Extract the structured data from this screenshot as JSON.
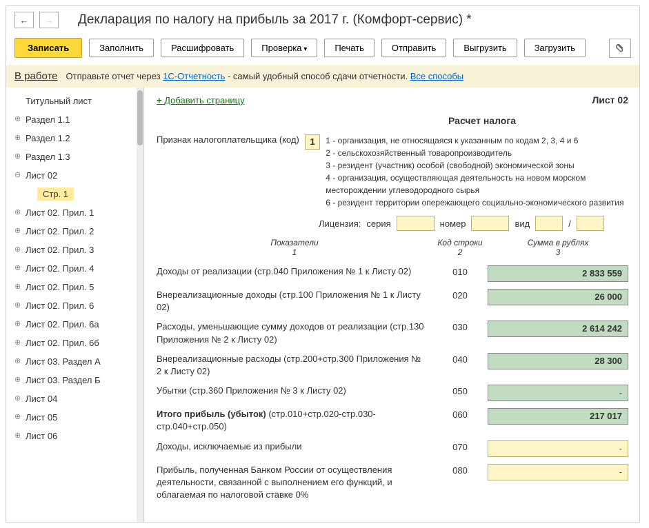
{
  "title": "Декларация по налогу на прибыль за 2017 г. (Комфорт-сервис) *",
  "toolbar": {
    "save": "Записать",
    "fill": "Заполнить",
    "decode": "Расшифровать",
    "check": "Проверка",
    "print": "Печать",
    "send": "Отправить",
    "export": "Выгрузить",
    "import": "Загрузить"
  },
  "info": {
    "status": "В работе",
    "text1": "Отправьте отчет через ",
    "link1": "1С-Отчетность",
    "text2": " - самый удобный способ сдачи отчетности. ",
    "link2": "Все способы"
  },
  "sidebar": [
    {
      "label": "Титульный лист",
      "leaf": true
    },
    {
      "label": "Раздел 1.1"
    },
    {
      "label": "Раздел 1.2"
    },
    {
      "label": "Раздел 1.3"
    },
    {
      "label": "Лист 02",
      "expanded": true
    },
    {
      "label": "Стр. 1",
      "level": 1,
      "leaf": true,
      "active": true
    },
    {
      "label": "Лист 02. Прил. 1"
    },
    {
      "label": "Лист 02. Прил. 2"
    },
    {
      "label": "Лист 02. Прил. 3"
    },
    {
      "label": "Лист 02. Прил. 4"
    },
    {
      "label": "Лист 02. Прил. 5"
    },
    {
      "label": "Лист 02. Прил. 6"
    },
    {
      "label": "Лист 02. Прил. 6а"
    },
    {
      "label": "Лист 02. Прил. 6б"
    },
    {
      "label": "Лист 03. Раздел А"
    },
    {
      "label": "Лист 03. Раздел Б"
    },
    {
      "label": "Лист 04"
    },
    {
      "label": "Лист 05"
    },
    {
      "label": "Лист 06"
    }
  ],
  "content": {
    "add_page": "Добавить страницу",
    "list_label": "Лист 02",
    "section_title": "Расчет налога",
    "taxpayer_label": "Признак налогоплательщика (код)",
    "taxpayer_code": "1",
    "legend": [
      "1 - организация, не относящаяся к указанным по кодам 2, 3, 4 и 6",
      "2 - сельскохозяйственный товаропроизводитель",
      "3 - резидент (участник) особой (свободной) экономической зоны",
      "4 - организация, осуществляющая деятельность на новом морском месторождении углеводородного сырья",
      "6 - резидент территории опережающего социально-экономического развития"
    ],
    "license": {
      "label": "Лицензия:",
      "series": "серия",
      "number": "номер",
      "type": "вид",
      "sep": "/"
    },
    "headers": {
      "indicator": "Показатели",
      "indicator_num": "1",
      "code": "Код строки",
      "code_num": "2",
      "sum": "Сумма в рублях",
      "sum_num": "3"
    },
    "rows": [
      {
        "label": "Доходы от реализации (стр.040 Приложения № 1 к Листу 02)",
        "code": "010",
        "value": "2 833 559",
        "style": "green"
      },
      {
        "label": "Внереализационные доходы (стр.100 Приложения № 1 к Листу 02)",
        "code": "020",
        "value": "26 000",
        "style": "green"
      },
      {
        "label": "Расходы, уменьшающие сумму доходов от реализации (стр.130 Приложения № 2 к Листу 02)",
        "code": "030",
        "value": "2 614 242",
        "style": "green"
      },
      {
        "label": "Внереализационные расходы (стр.200+стр.300 Приложения № 2 к Листу 02)",
        "code": "040",
        "value": "28 300",
        "style": "green"
      },
      {
        "label": "Убытки (стр.360 Приложения № 3 к Листу 02)",
        "code": "050",
        "value": "-",
        "style": "green",
        "empty": true
      },
      {
        "label": "Итого прибыль (убыток)",
        "extra": "(стр.010+стр.020-стр.030-стр.040+стр.050)",
        "bold": true,
        "code": "060",
        "value": "217 017",
        "style": "green"
      },
      {
        "label": "Доходы, исключаемые из прибыли",
        "code": "070",
        "value": "-",
        "style": "yellow",
        "empty": true
      },
      {
        "label": "Прибыль, полученная Банком России от осуществления деятельности, связанной с выполнением его функций, и облагаемая по налоговой ставке 0%",
        "code": "080",
        "value": "-",
        "style": "yellow",
        "empty": true
      }
    ]
  }
}
